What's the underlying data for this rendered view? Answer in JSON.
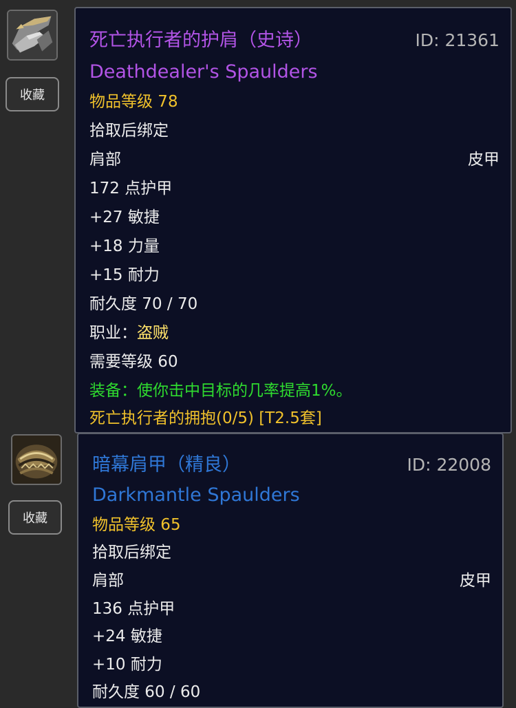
{
  "colors": {
    "epic": "#b254e6",
    "rare": "#2f77d6",
    "item_level": "#f0c12b",
    "class_value": "#ffe26a",
    "equip_effect": "#2fdb2f",
    "set_bonus": "#f0c12b",
    "text": "#ececec",
    "id": "#b5b5b5",
    "tooltip_bg": "#0c0f24"
  },
  "items": [
    {
      "icon": "shoulder-armor-icon",
      "favorite_label": "收藏",
      "title": "死亡执行者的护肩（史诗）",
      "id_label": "ID: 21361",
      "english_name": "Deathdealer's Spaulders",
      "item_level": "物品等级 78",
      "bind": "拾取后绑定",
      "slot": "肩部",
      "armor_type": "皮甲",
      "armor": "172 点护甲",
      "stats": [
        "+27 敏捷",
        "+18 力量",
        "+15 耐力"
      ],
      "durability": "耐久度 70 / 70",
      "class_label": "职业：",
      "class_value": "盗贼",
      "required_level": "需要等级 60",
      "equip_effect": "装备：使你击中目标的几率提高1%。",
      "set_bonus": "死亡执行者的拥抱(0/5) [T2.5套]"
    },
    {
      "icon": "shoulder-armor-icon",
      "favorite_label": "收藏",
      "title": "暗幕肩甲（精良）",
      "id_label": "ID: 22008",
      "english_name": "Darkmantle Spaulders",
      "item_level": "物品等级 65",
      "bind": "拾取后绑定",
      "slot": "肩部",
      "armor_type": "皮甲",
      "armor": "136 点护甲",
      "stats": [
        "+24 敏捷",
        "+10 耐力"
      ],
      "durability": "耐久度 60 / 60"
    }
  ]
}
